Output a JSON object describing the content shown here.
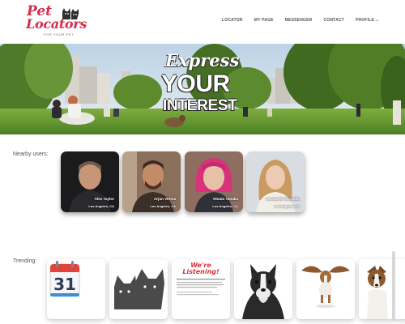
{
  "brand": {
    "name_line1": "Pet",
    "name_line2": "Locators",
    "tagline": "FOR YOUR PET",
    "color": "#d42e4e"
  },
  "nav": {
    "items": [
      "LOCATOR",
      "MY PAGE",
      "MESSENGER",
      "CONTACT",
      "PROFILE ⌄"
    ]
  },
  "hero": {
    "line1": "Express",
    "line2": "YOUR",
    "line3": "INTEREST"
  },
  "nearby": {
    "label": "Nearby users:",
    "users": [
      {
        "name": "Alex Taylor",
        "location": "Los Angeles, CA"
      },
      {
        "name": "Arjun Verma",
        "location": "Los Angeles, CA"
      },
      {
        "name": "Hinata Tanaka",
        "location": "Los Angeles, CA"
      },
      {
        "name": "Leonardo Esposito",
        "location": "Los Angeles, CA"
      }
    ]
  },
  "trending": {
    "label": "Trending:",
    "calendar_day": "31",
    "listening_title_1": "We're",
    "listening_title_2": "Listening!",
    "icons": [
      "calendar-icon",
      "pets-icon",
      "listening-icon",
      "boston-terrier-photo",
      "flying-dog-photo",
      "jack-russell-photo"
    ]
  },
  "colors": {
    "accent": "#d42e4e",
    "calendar_red": "#e0453c",
    "calendar_blue": "#3d8fd6"
  }
}
